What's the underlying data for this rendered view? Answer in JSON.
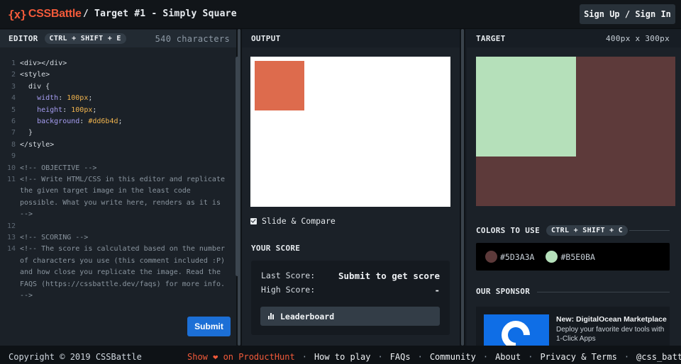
{
  "header": {
    "logo_glyph": "{x}",
    "logo_text": "CSSBattle",
    "target_title": "/ Target #1 - Simply Square",
    "signin_label": "Sign Up / Sign In"
  },
  "editor": {
    "title": "EDITOR",
    "shortcut": "CTRL + SHIFT + E",
    "char_count": "540 characters",
    "lines": [
      {
        "n": "1",
        "parts": [
          {
            "c": "tag",
            "t": "<div></div>"
          }
        ]
      },
      {
        "n": "2",
        "parts": [
          {
            "c": "tag",
            "t": "<style>"
          }
        ]
      },
      {
        "n": "3",
        "parts": [
          {
            "c": "tag",
            "t": "  div {"
          }
        ]
      },
      {
        "n": "4",
        "parts": [
          {
            "c": "prop",
            "t": "    width"
          },
          {
            "c": "tag",
            "t": ": "
          },
          {
            "c": "val",
            "t": "100px"
          },
          {
            "c": "tag",
            "t": ";"
          }
        ]
      },
      {
        "n": "5",
        "parts": [
          {
            "c": "prop",
            "t": "    height"
          },
          {
            "c": "tag",
            "t": ": "
          },
          {
            "c": "val",
            "t": "100px"
          },
          {
            "c": "tag",
            "t": ";"
          }
        ]
      },
      {
        "n": "6",
        "parts": [
          {
            "c": "prop",
            "t": "    background"
          },
          {
            "c": "tag",
            "t": ": "
          },
          {
            "c": "val",
            "t": "#dd6b4d"
          },
          {
            "c": "tag",
            "t": ";"
          }
        ]
      },
      {
        "n": "7",
        "parts": [
          {
            "c": "tag",
            "t": "  }"
          }
        ]
      },
      {
        "n": "8",
        "parts": [
          {
            "c": "tag",
            "t": "</style>"
          }
        ]
      },
      {
        "n": "9",
        "parts": []
      },
      {
        "n": "10",
        "parts": [
          {
            "c": "cmt",
            "t": "<!-- OBJECTIVE -->"
          }
        ]
      },
      {
        "n": "11",
        "parts": [
          {
            "c": "cmt",
            "t": "<!-- Write HTML/CSS in this editor and replicate"
          }
        ]
      },
      {
        "n": "",
        "parts": [
          {
            "c": "cmt",
            "t": "the given target image in the least code"
          }
        ]
      },
      {
        "n": "",
        "parts": [
          {
            "c": "cmt",
            "t": "possible. What you write here, renders as it is"
          }
        ]
      },
      {
        "n": "",
        "parts": [
          {
            "c": "cmt",
            "t": "-->"
          }
        ]
      },
      {
        "n": "12",
        "parts": []
      },
      {
        "n": "13",
        "parts": [
          {
            "c": "cmt",
            "t": "<!-- SCORING -->"
          }
        ]
      },
      {
        "n": "14",
        "parts": [
          {
            "c": "cmt",
            "t": "<!-- The score is calculated based on the number"
          }
        ]
      },
      {
        "n": "",
        "parts": [
          {
            "c": "cmt",
            "t": "of characters you use (this comment included :P)"
          }
        ]
      },
      {
        "n": "",
        "parts": [
          {
            "c": "cmt",
            "t": "and how close you replicate the image. Read the"
          }
        ]
      },
      {
        "n": "",
        "parts": [
          {
            "c": "cmt",
            "t": "FAQS (https://cssbattle.dev/faqs) for more info."
          }
        ]
      },
      {
        "n": "",
        "parts": [
          {
            "c": "cmt",
            "t": "-->"
          }
        ]
      }
    ],
    "submit_label": "Submit"
  },
  "output": {
    "title": "OUTPUT",
    "square_color": "#dd6b4d",
    "slide_compare_label": "Slide & Compare",
    "slide_compare_checked": true,
    "score_title": "YOUR SCORE",
    "last_score_label": "Last Score:",
    "last_score_value": "Submit to get score",
    "high_score_label": "High Score:",
    "high_score_value": "-",
    "leaderboard_label": "Leaderboard",
    "leaderboard_icon": "bar-chart-icon"
  },
  "target": {
    "title": "TARGET",
    "size": "400px x 300px",
    "bg_color": "#5D3A3A",
    "square_color": "#B5E0BA",
    "colors_title": "COLORS TO USE",
    "colors_shortcut": "CTRL + SHIFT + C",
    "colors": [
      {
        "hex": "#5D3A3A",
        "label": "#5D3A3A"
      },
      {
        "hex": "#B5E0BA",
        "label": "#B5E0BA"
      }
    ],
    "sponsor_title": "OUR SPONSOR",
    "sponsor_heading": "New: DigitalOcean Marketplace",
    "sponsor_text": "Deploy your favorite dev tools with 1-Click Apps"
  },
  "footer": {
    "copyright": "Copyright © 2019 CSSBattle",
    "links": [
      {
        "label": "Show ❤ on ProductHunt",
        "accent": true
      },
      {
        "label": "How to play",
        "accent": false
      },
      {
        "label": "FAQs",
        "accent": false
      },
      {
        "label": "Community",
        "accent": false
      },
      {
        "label": "About",
        "accent": false
      },
      {
        "label": "Privacy & Terms",
        "accent": false
      },
      {
        "label": "@css_battle",
        "accent": false
      }
    ],
    "separator": "·"
  }
}
